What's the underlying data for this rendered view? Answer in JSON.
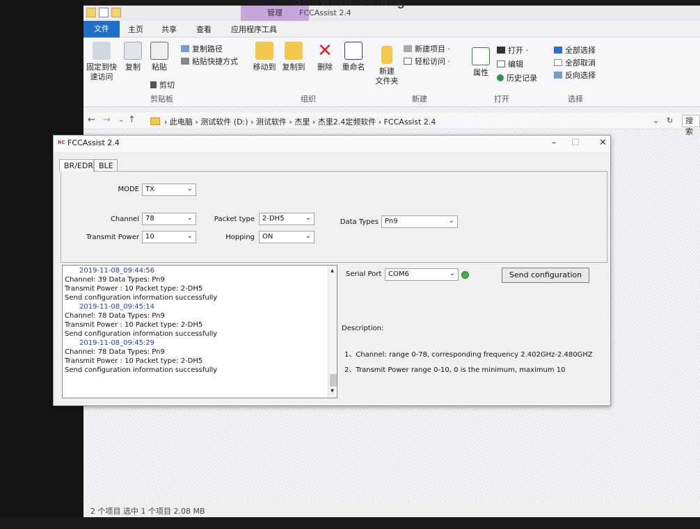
{
  "caption": "Software Setting",
  "explorer": {
    "context_tab": "管理",
    "title": "FCCAssist 2.4",
    "tabs": [
      "文件",
      "主页",
      "共享",
      "查看",
      "应用程序工具"
    ],
    "ribbon": {
      "pin_label_1": "固定到快",
      "pin_label_2": "速访问",
      "copy": "复制",
      "paste": "粘贴",
      "copy_path": "复制路径",
      "paste_shortcut": "粘贴快捷方式",
      "cut": "剪切",
      "group_clipboard": "剪贴板",
      "move_to": "移动到",
      "copy_to": "复制到",
      "delete": "删除",
      "rename": "重命名",
      "group_organize": "组织",
      "new_folder_1": "新建",
      "new_folder_2": "文件夹",
      "new_item": "新建项目 ·",
      "easy_access": "轻松访问 ·",
      "group_new": "新建",
      "properties": "属性",
      "open": "打开 ·",
      "edit": "编辑",
      "history": "历史记录",
      "group_open": "打开",
      "select_all": "全部选择",
      "select_none": "全部取消",
      "invert_selection": "反向选择",
      "group_select": "选择"
    },
    "address": {
      "back": "←",
      "forward": "→",
      "recent": "⌄",
      "up": "↑",
      "path": "› 此电脑 › 测试软件 (D:) › 测试软件 › 杰里 › 杰里2.4定频软件 › FCCAssist 2.4",
      "dropdown": "⌄",
      "refresh": "↻",
      "search": "搜索"
    },
    "status": "2 个项目   选中 1 个项目 2.08 MB"
  },
  "fcc": {
    "title": "FCCAssist 2.4",
    "tabs": [
      "BR/EDR",
      "BLE"
    ],
    "form": {
      "mode_label": "MODE",
      "mode_value": "TX",
      "channel_label": "Channel",
      "channel_value": "78",
      "packet_type_label": "Packet type",
      "packet_type_value": "2-DH5",
      "data_types_label": "Data Types",
      "data_types_value": "Pn9",
      "transmit_power_label": "Transmit Power",
      "transmit_power_value": "10",
      "hopping_label": "Hopping",
      "hopping_value": "ON"
    },
    "log": [
      {
        "date": "2019-11-08_09:44:56",
        "l1": "Channel: 39        Data Types: Pn9",
        "l2": "Transmit Power : 10     Packet type: 2-DH5",
        "l3": "Send configuration information successfully"
      },
      {
        "date": "2019-11-08_09:45:14",
        "l1": "Channel: 78        Data Types: Pn9",
        "l2": "Transmit Power : 10     Packet type: 2-DH5",
        "l3": "Send configuration information successfully"
      },
      {
        "date": "2019-11-08_09:45:29",
        "l1": "Channel: 78        Data Types: Pn9",
        "l2": "Transmit Power : 10     Packet type: 2-DH5",
        "l3": "Send configuration information successfully"
      }
    ],
    "serial_port_label": "Serial Port",
    "serial_port_value": "COM6",
    "send_button": "Send configuration",
    "description_title": "Description:",
    "description_1": "1、Channel: range 0-78, corresponding frequency 2.402GHz-2.480GHZ",
    "description_2": "2、Transmit Power  range 0-10, 0 is the minimum, maximum 10"
  }
}
